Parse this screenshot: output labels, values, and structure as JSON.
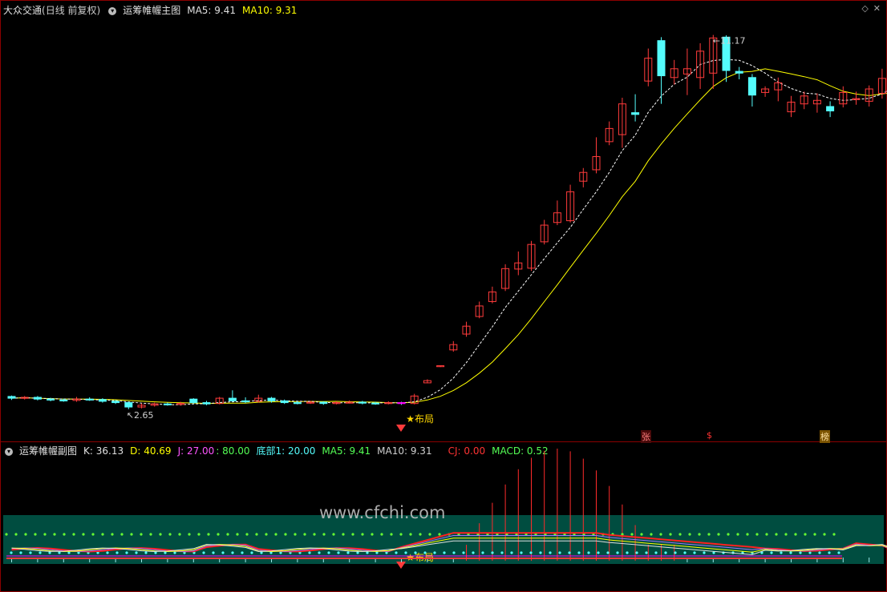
{
  "main_header": {
    "stock": "大众交通",
    "period": "(日线 前复权)",
    "indicator": "运筹帷幄主图",
    "ma5": "MA5: 9.41",
    "ma10": "MA10: 9.31"
  },
  "sub_header": {
    "indicator": "运筹帷幄副图",
    "k": "K: 36.13",
    "d": "D: 40.69",
    "j": "J: 27.00",
    "level": ": 80.00",
    "bottom": "底部1: 20.00",
    "ma5": "MA5: 9.41",
    "ma10": "MA10: 9.31",
    "cj": "CJ: 0.00",
    "macd": "MACD: 0.52"
  },
  "annotations": {
    "high_label": "11.17",
    "low_label": "2.65",
    "buju_main": "★布局",
    "buju_sub": "★布局",
    "signal_zhang": "张",
    "signal_s": "$",
    "signal_bang": "榜"
  },
  "watermark": "www.cfchi.com",
  "colors": {
    "up": "#ff3b3b",
    "down": "#54fcfc",
    "ma5": "#ffffff",
    "ma10": "#ffff00",
    "sub_bg": "#004d40",
    "frame": "#8b0000"
  },
  "chart_data": {
    "type": "candlestick",
    "price_range": [
      2.3,
      11.6
    ],
    "candles": [
      {
        "o": 2.94,
        "c": 2.9,
        "h": 2.96,
        "l": 2.86
      },
      {
        "o": 2.9,
        "c": 2.92,
        "h": 2.95,
        "l": 2.87
      },
      {
        "o": 2.92,
        "c": 2.88,
        "h": 2.95,
        "l": 2.85
      },
      {
        "o": 2.88,
        "c": 2.86,
        "h": 2.91,
        "l": 2.83
      },
      {
        "o": 2.86,
        "c": 2.85,
        "h": 2.89,
        "l": 2.82
      },
      {
        "o": 2.85,
        "c": 2.88,
        "h": 2.93,
        "l": 2.82
      },
      {
        "o": 2.88,
        "c": 2.87,
        "h": 2.92,
        "l": 2.84
      },
      {
        "o": 2.87,
        "c": 2.83,
        "h": 2.9,
        "l": 2.8
      },
      {
        "o": 2.83,
        "c": 2.8,
        "h": 2.86,
        "l": 2.77
      },
      {
        "o": 2.8,
        "c": 2.7,
        "h": 2.82,
        "l": 2.65
      },
      {
        "o": 2.7,
        "c": 2.74,
        "h": 2.78,
        "l": 2.67
      },
      {
        "o": 2.74,
        "c": 2.77,
        "h": 2.8,
        "l": 2.71
      },
      {
        "o": 2.77,
        "c": 2.76,
        "h": 2.8,
        "l": 2.73
      },
      {
        "o": 2.76,
        "c": 2.78,
        "h": 2.82,
        "l": 2.73
      },
      {
        "o": 2.88,
        "c": 2.8,
        "h": 2.9,
        "l": 2.78
      },
      {
        "o": 2.8,
        "c": 2.77,
        "h": 2.84,
        "l": 2.74
      },
      {
        "o": 2.78,
        "c": 2.9,
        "h": 2.93,
        "l": 2.76
      },
      {
        "o": 2.9,
        "c": 2.84,
        "h": 3.08,
        "l": 2.82
      },
      {
        "o": 2.84,
        "c": 2.82,
        "h": 2.92,
        "l": 2.79
      },
      {
        "o": 2.83,
        "c": 2.9,
        "h": 2.98,
        "l": 2.8
      },
      {
        "o": 2.9,
        "c": 2.84,
        "h": 2.93,
        "l": 2.8
      },
      {
        "o": 2.84,
        "c": 2.8,
        "h": 2.87,
        "l": 2.77
      },
      {
        "o": 2.8,
        "c": 2.79,
        "h": 2.83,
        "l": 2.76
      },
      {
        "o": 2.79,
        "c": 2.81,
        "h": 2.84,
        "l": 2.77
      },
      {
        "o": 2.81,
        "c": 2.78,
        "h": 2.83,
        "l": 2.75
      },
      {
        "o": 2.78,
        "c": 2.8,
        "h": 2.83,
        "l": 2.76
      },
      {
        "o": 2.8,
        "c": 2.81,
        "h": 2.85,
        "l": 2.78
      },
      {
        "o": 2.81,
        "c": 2.79,
        "h": 2.84,
        "l": 2.76
      },
      {
        "o": 2.79,
        "c": 2.78,
        "h": 2.82,
        "l": 2.75
      },
      {
        "o": 2.78,
        "c": 2.8,
        "h": 2.83,
        "l": 2.76
      },
      {
        "o": 2.8,
        "c": 2.78,
        "h": 2.82,
        "l": 2.75
      },
      {
        "o": 2.78,
        "c": 2.95,
        "h": 3.0,
        "l": 2.76
      },
      {
        "o": 3.25,
        "c": 3.3,
        "h": 3.33,
        "l": 3.24
      },
      {
        "o": 3.62,
        "c": 3.64,
        "h": 3.65,
        "l": 3.61
      },
      {
        "o": 4.0,
        "c": 4.12,
        "h": 4.2,
        "l": 3.96
      },
      {
        "o": 4.36,
        "c": 4.54,
        "h": 4.64,
        "l": 4.3
      },
      {
        "o": 4.76,
        "c": 5.0,
        "h": 5.1,
        "l": 4.72
      },
      {
        "o": 5.1,
        "c": 5.32,
        "h": 5.44,
        "l": 5.06
      },
      {
        "o": 5.4,
        "c": 5.85,
        "h": 5.95,
        "l": 5.34
      },
      {
        "o": 5.84,
        "c": 5.98,
        "h": 6.24,
        "l": 5.7
      },
      {
        "o": 5.86,
        "c": 6.4,
        "h": 6.48,
        "l": 5.8
      },
      {
        "o": 6.46,
        "c": 6.84,
        "h": 6.96,
        "l": 6.4
      },
      {
        "o": 6.9,
        "c": 7.12,
        "h": 7.4,
        "l": 6.84
      },
      {
        "o": 6.94,
        "c": 7.6,
        "h": 7.76,
        "l": 6.9
      },
      {
        "o": 7.84,
        "c": 8.04,
        "h": 8.14,
        "l": 7.7
      },
      {
        "o": 8.1,
        "c": 8.4,
        "h": 8.84,
        "l": 8.02
      },
      {
        "o": 8.74,
        "c": 9.04,
        "h": 9.2,
        "l": 8.66
      },
      {
        "o": 8.9,
        "c": 9.6,
        "h": 9.74,
        "l": 8.6
      },
      {
        "o": 9.4,
        "c": 9.36,
        "h": 9.82,
        "l": 9.2
      },
      {
        "o": 10.12,
        "c": 10.64,
        "h": 10.86,
        "l": 10.0
      },
      {
        "o": 11.04,
        "c": 10.24,
        "h": 11.12,
        "l": 9.6
      },
      {
        "o": 10.2,
        "c": 10.4,
        "h": 10.6,
        "l": 10.04
      },
      {
        "o": 10.28,
        "c": 10.4,
        "h": 10.86,
        "l": 9.8
      },
      {
        "o": 10.2,
        "c": 10.8,
        "h": 10.98,
        "l": 9.94
      },
      {
        "o": 10.3,
        "c": 11.1,
        "h": 11.17,
        "l": 9.94
      },
      {
        "o": 11.12,
        "c": 10.36,
        "h": 11.16,
        "l": 10.1
      },
      {
        "o": 10.34,
        "c": 10.3,
        "h": 10.44,
        "l": 10.16
      },
      {
        "o": 10.2,
        "c": 9.8,
        "h": 10.28,
        "l": 9.54
      },
      {
        "o": 9.86,
        "c": 9.94,
        "h": 10.0,
        "l": 9.76
      },
      {
        "o": 9.92,
        "c": 10.08,
        "h": 10.2,
        "l": 9.66
      },
      {
        "o": 9.42,
        "c": 9.64,
        "h": 9.78,
        "l": 9.3
      },
      {
        "o": 9.6,
        "c": 9.78,
        "h": 9.88,
        "l": 9.48
      },
      {
        "o": 9.6,
        "c": 9.68,
        "h": 9.84,
        "l": 9.4
      },
      {
        "o": 9.54,
        "c": 9.44,
        "h": 9.66,
        "l": 9.3
      },
      {
        "o": 9.6,
        "c": 9.86,
        "h": 10.0,
        "l": 9.52
      },
      {
        "o": 9.7,
        "c": 9.72,
        "h": 9.88,
        "l": 9.58
      },
      {
        "o": 9.66,
        "c": 9.94,
        "h": 10.02,
        "l": 9.54
      },
      {
        "o": 9.84,
        "c": 10.18,
        "h": 10.4,
        "l": 9.72
      },
      {
        "o": 10.04,
        "c": 10.3,
        "h": 10.64,
        "l": 9.86
      },
      {
        "o": 10.2,
        "c": 9.62,
        "h": 10.42,
        "l": 9.56
      },
      {
        "o": 9.58,
        "c": 9.62,
        "h": 9.68,
        "l": 9.3
      }
    ],
    "sub": {
      "k_level": 80.0,
      "bottom_level": 20.0,
      "kdj_range": [
        -10,
        100
      ]
    }
  }
}
